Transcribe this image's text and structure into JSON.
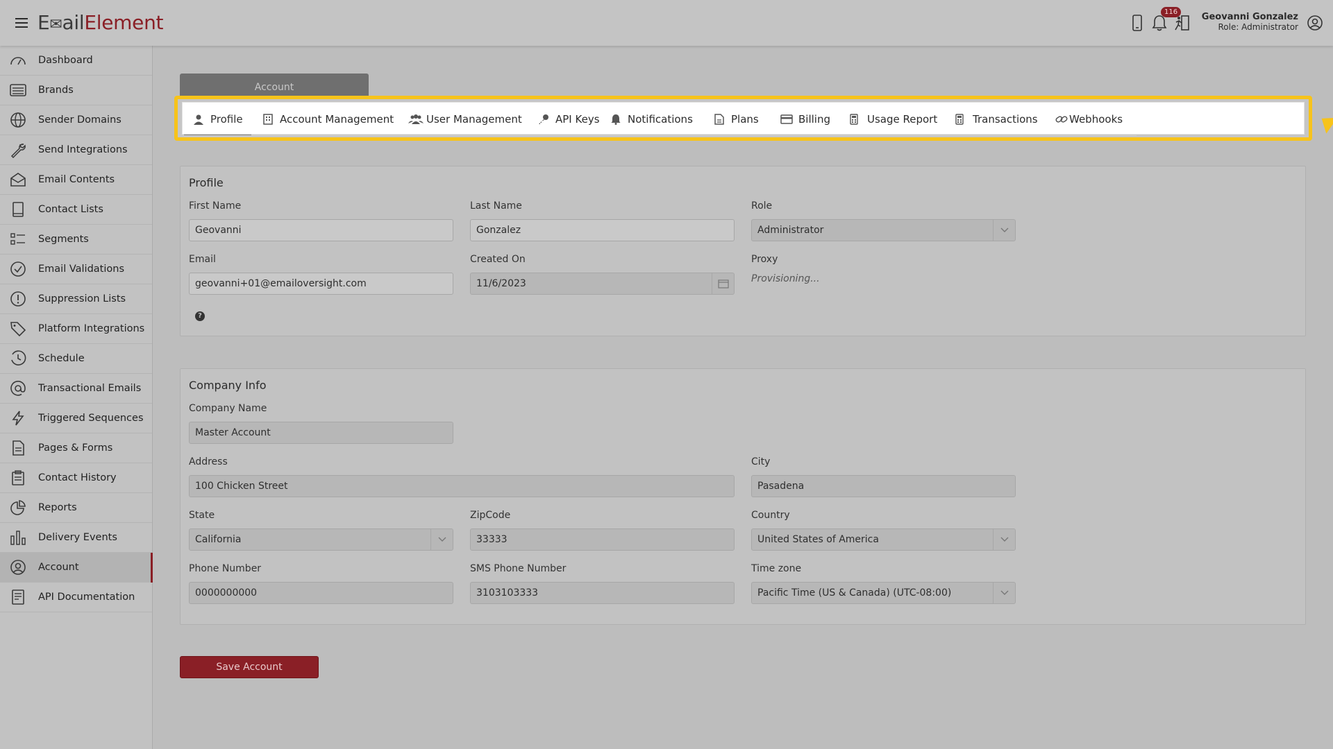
{
  "app": {
    "logo_part1": "E",
    "logo_part2": "ail",
    "logo_part3": "Element"
  },
  "header": {
    "notification_count": "116",
    "user_name": "Geovanni Gonzalez",
    "user_role": "Role: Administrator"
  },
  "sidebar": {
    "items": [
      {
        "label": "Dashboard",
        "icon": "gauge-icon"
      },
      {
        "label": "Brands",
        "icon": "list-icon"
      },
      {
        "label": "Sender Domains",
        "icon": "globe-icon"
      },
      {
        "label": "Send Integrations",
        "icon": "wrench-icon"
      },
      {
        "label": "Email Contents",
        "icon": "envelope-open-icon"
      },
      {
        "label": "Contact Lists",
        "icon": "book-icon"
      },
      {
        "label": "Segments",
        "icon": "list-check-icon"
      },
      {
        "label": "Email Validations",
        "icon": "check-circle-icon"
      },
      {
        "label": "Suppression Lists",
        "icon": "exclamation-circle-icon"
      },
      {
        "label": "Platform Integrations",
        "icon": "tag-icon"
      },
      {
        "label": "Schedule",
        "icon": "clock-icon"
      },
      {
        "label": "Transactional Emails",
        "icon": "at-icon"
      },
      {
        "label": "Triggered Sequences",
        "icon": "bolt-icon"
      },
      {
        "label": "Pages & Forms",
        "icon": "file-icon"
      },
      {
        "label": "Contact History",
        "icon": "clipboard-icon"
      },
      {
        "label": "Reports",
        "icon": "pie-chart-icon"
      },
      {
        "label": "Delivery Events",
        "icon": "bar-chart-icon"
      },
      {
        "label": "Account",
        "icon": "user-circle-icon",
        "active": true
      },
      {
        "label": "API Documentation",
        "icon": "document-icon"
      }
    ]
  },
  "account_tab": "Account",
  "tabs": [
    {
      "label": "Profile",
      "icon": "user-icon",
      "selected": true
    },
    {
      "label": "Account Management",
      "icon": "building-icon"
    },
    {
      "label": "User Management",
      "icon": "users-icon"
    },
    {
      "label": "API Keys",
      "icon": "key-icon"
    },
    {
      "label": "Notifications",
      "icon": "bell-icon"
    },
    {
      "label": "Plans",
      "icon": "file-text-icon"
    },
    {
      "label": "Billing",
      "icon": "credit-card-icon"
    },
    {
      "label": "Usage Report",
      "icon": "calculator-icon"
    },
    {
      "label": "Transactions",
      "icon": "calculator-icon"
    },
    {
      "label": "Webhooks",
      "icon": "link-icon"
    }
  ],
  "profile": {
    "title": "Profile",
    "first_name_label": "First Name",
    "first_name": "Geovanni",
    "last_name_label": "Last Name",
    "last_name": "Gonzalez",
    "role_label": "Role",
    "role": "Administrator",
    "email_label": "Email",
    "email": "geovanni+01@emailoversight.com",
    "created_on_label": "Created On",
    "created_on": "11/6/2023",
    "proxy_label": "Proxy",
    "proxy": "Provisioning..."
  },
  "company": {
    "title": "Company Info",
    "company_name_label": "Company Name",
    "company_name": "Master Account",
    "address_label": "Address",
    "address": "100 Chicken Street",
    "city_label": "City",
    "city": "Pasadena",
    "state_label": "State",
    "state": "California",
    "zip_label": "ZipCode",
    "zip": "33333",
    "country_label": "Country",
    "country": "United States of America",
    "phone_label": "Phone Number",
    "phone": "0000000000",
    "sms_label": "SMS Phone Number",
    "sms": "3103103333",
    "timezone_label": "Time zone",
    "timezone": "Pacific Time (US & Canada) (UTC-08:00)"
  },
  "save_label": "Save Account",
  "colors": {
    "brand": "#8a1f26",
    "highlight": "#f7c31a"
  }
}
